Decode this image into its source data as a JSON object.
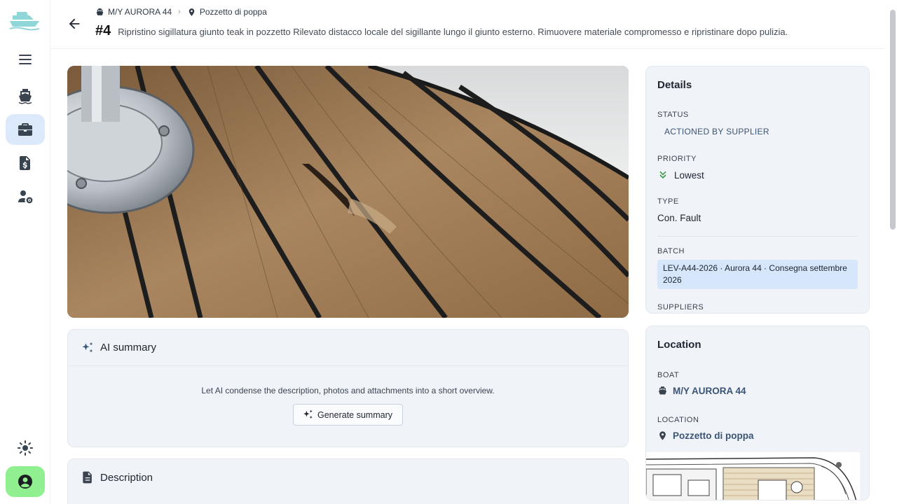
{
  "header": {
    "breadcrumb_boat": "M/Y AURORA 44",
    "breadcrumb_location": "Pozzetto di poppa",
    "issue_number": "#4",
    "issue_title": "Ripristino sigillatura giunto teak in pozzetto Rilevato distacco locale del sigillante lungo il giunto esterno. Rimuovere materiale compromesso e ripristinare dopo pulizia."
  },
  "ai_summary": {
    "title": "AI summary",
    "hint": "Let AI condense the description, photos and attachments into a short overview.",
    "button_label": "Generate summary"
  },
  "description": {
    "title": "Description"
  },
  "details": {
    "title": "Details",
    "status_label": "STATUS",
    "status_value": "ACTIONED BY SUPPLIER",
    "priority_label": "PRIORITY",
    "priority_value": "Lowest",
    "type_label": "TYPE",
    "type_value": "Con. Fault",
    "batch_label": "BATCH",
    "batch_value": "LEV-A44-2026 · Aurora 44 · Consegna settembre 2026",
    "suppliers_label": "SUPPLIERS"
  },
  "location": {
    "title": "Location",
    "boat_label": "BOAT",
    "boat_value": "M/Y AURORA 44",
    "location_label": "LOCATION",
    "location_value": "Pozzetto di poppa"
  },
  "colors": {
    "accent_active": "#dbe9fb",
    "account_button": "#90f08f",
    "link": "#3b5574",
    "priority_icon": "#3a9a4a"
  }
}
